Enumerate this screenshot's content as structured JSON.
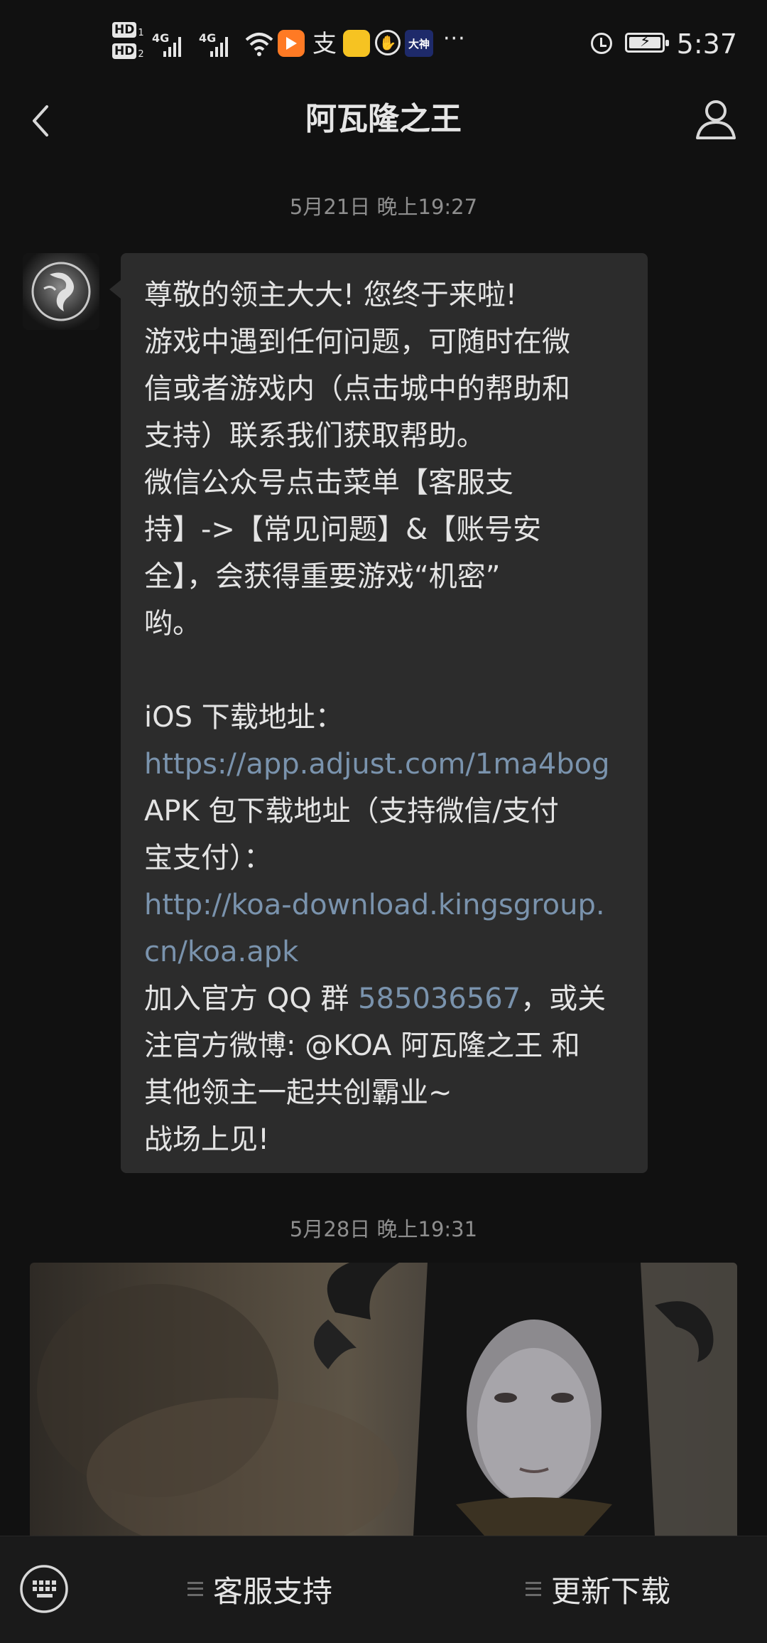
{
  "status_bar": {
    "hd1": "HD",
    "hd1_num": "1",
    "hd2": "HD",
    "hd2_num": "2",
    "signal1_label": "4G",
    "signal2_label": "4G",
    "alipay_glyph": "支",
    "dashen_label": "大神",
    "more": "···",
    "time": "5:37",
    "icons": [
      "hd-icon",
      "signal-icon",
      "wifi-icon",
      "video-app-icon",
      "alipay-icon",
      "yellow-app-icon",
      "hand-icon",
      "dashen-icon",
      "more-icon",
      "alarm-icon",
      "battery-icon"
    ]
  },
  "header": {
    "title": "阿瓦隆之王",
    "back_icon": "chevron-left-icon",
    "profile_icon": "person-icon"
  },
  "chat": {
    "timestamp1": "5月21日 晚上19:27",
    "timestamp2": "5月28日 晚上19:31",
    "message": {
      "l1": "尊敬的领主大大! 您终于来啦!",
      "l2": "游戏中遇到任何问题，可随时在微",
      "l3": "信或者游戏内（点击城中的帮助和",
      "l4": "支持）联系我们获取帮助。",
      "l5": "微信公众号点击菜单【客服支",
      "l6": "持】->【常见问题】&【账号安",
      "l7": "全】，会获得重要游戏“机密”",
      "l8": "哟。",
      "l10": "iOS 下载地址：",
      "ios_link": "https://app.adjust.com/1ma4bog",
      "l12": "APK 包下载地址（支持微信/支付",
      "l13": "宝支付）：",
      "apk_link_1": "http://koa-download.kingsgroup.",
      "apk_link_2": "cn/koa.apk",
      "qq_prefix": "加入官方 QQ 群 ",
      "qq_number": "585036567",
      "qq_suffix": "，或关",
      "l17": "注官方微博: @KOA 阿瓦隆之王 和",
      "l18": "其他领主一起共创霸业~",
      "l19": "战场上见!"
    }
  },
  "bottom_bar": {
    "keyboard_icon": "keyboard-icon",
    "menu1": "客服支持",
    "menu2": "更新下载",
    "menu_icon": "menu-lines-icon"
  },
  "colors": {
    "background": "#111111",
    "bubble": "#2c2c2c",
    "link": "#7a93ad",
    "timestamp": "#8e8e8e"
  }
}
